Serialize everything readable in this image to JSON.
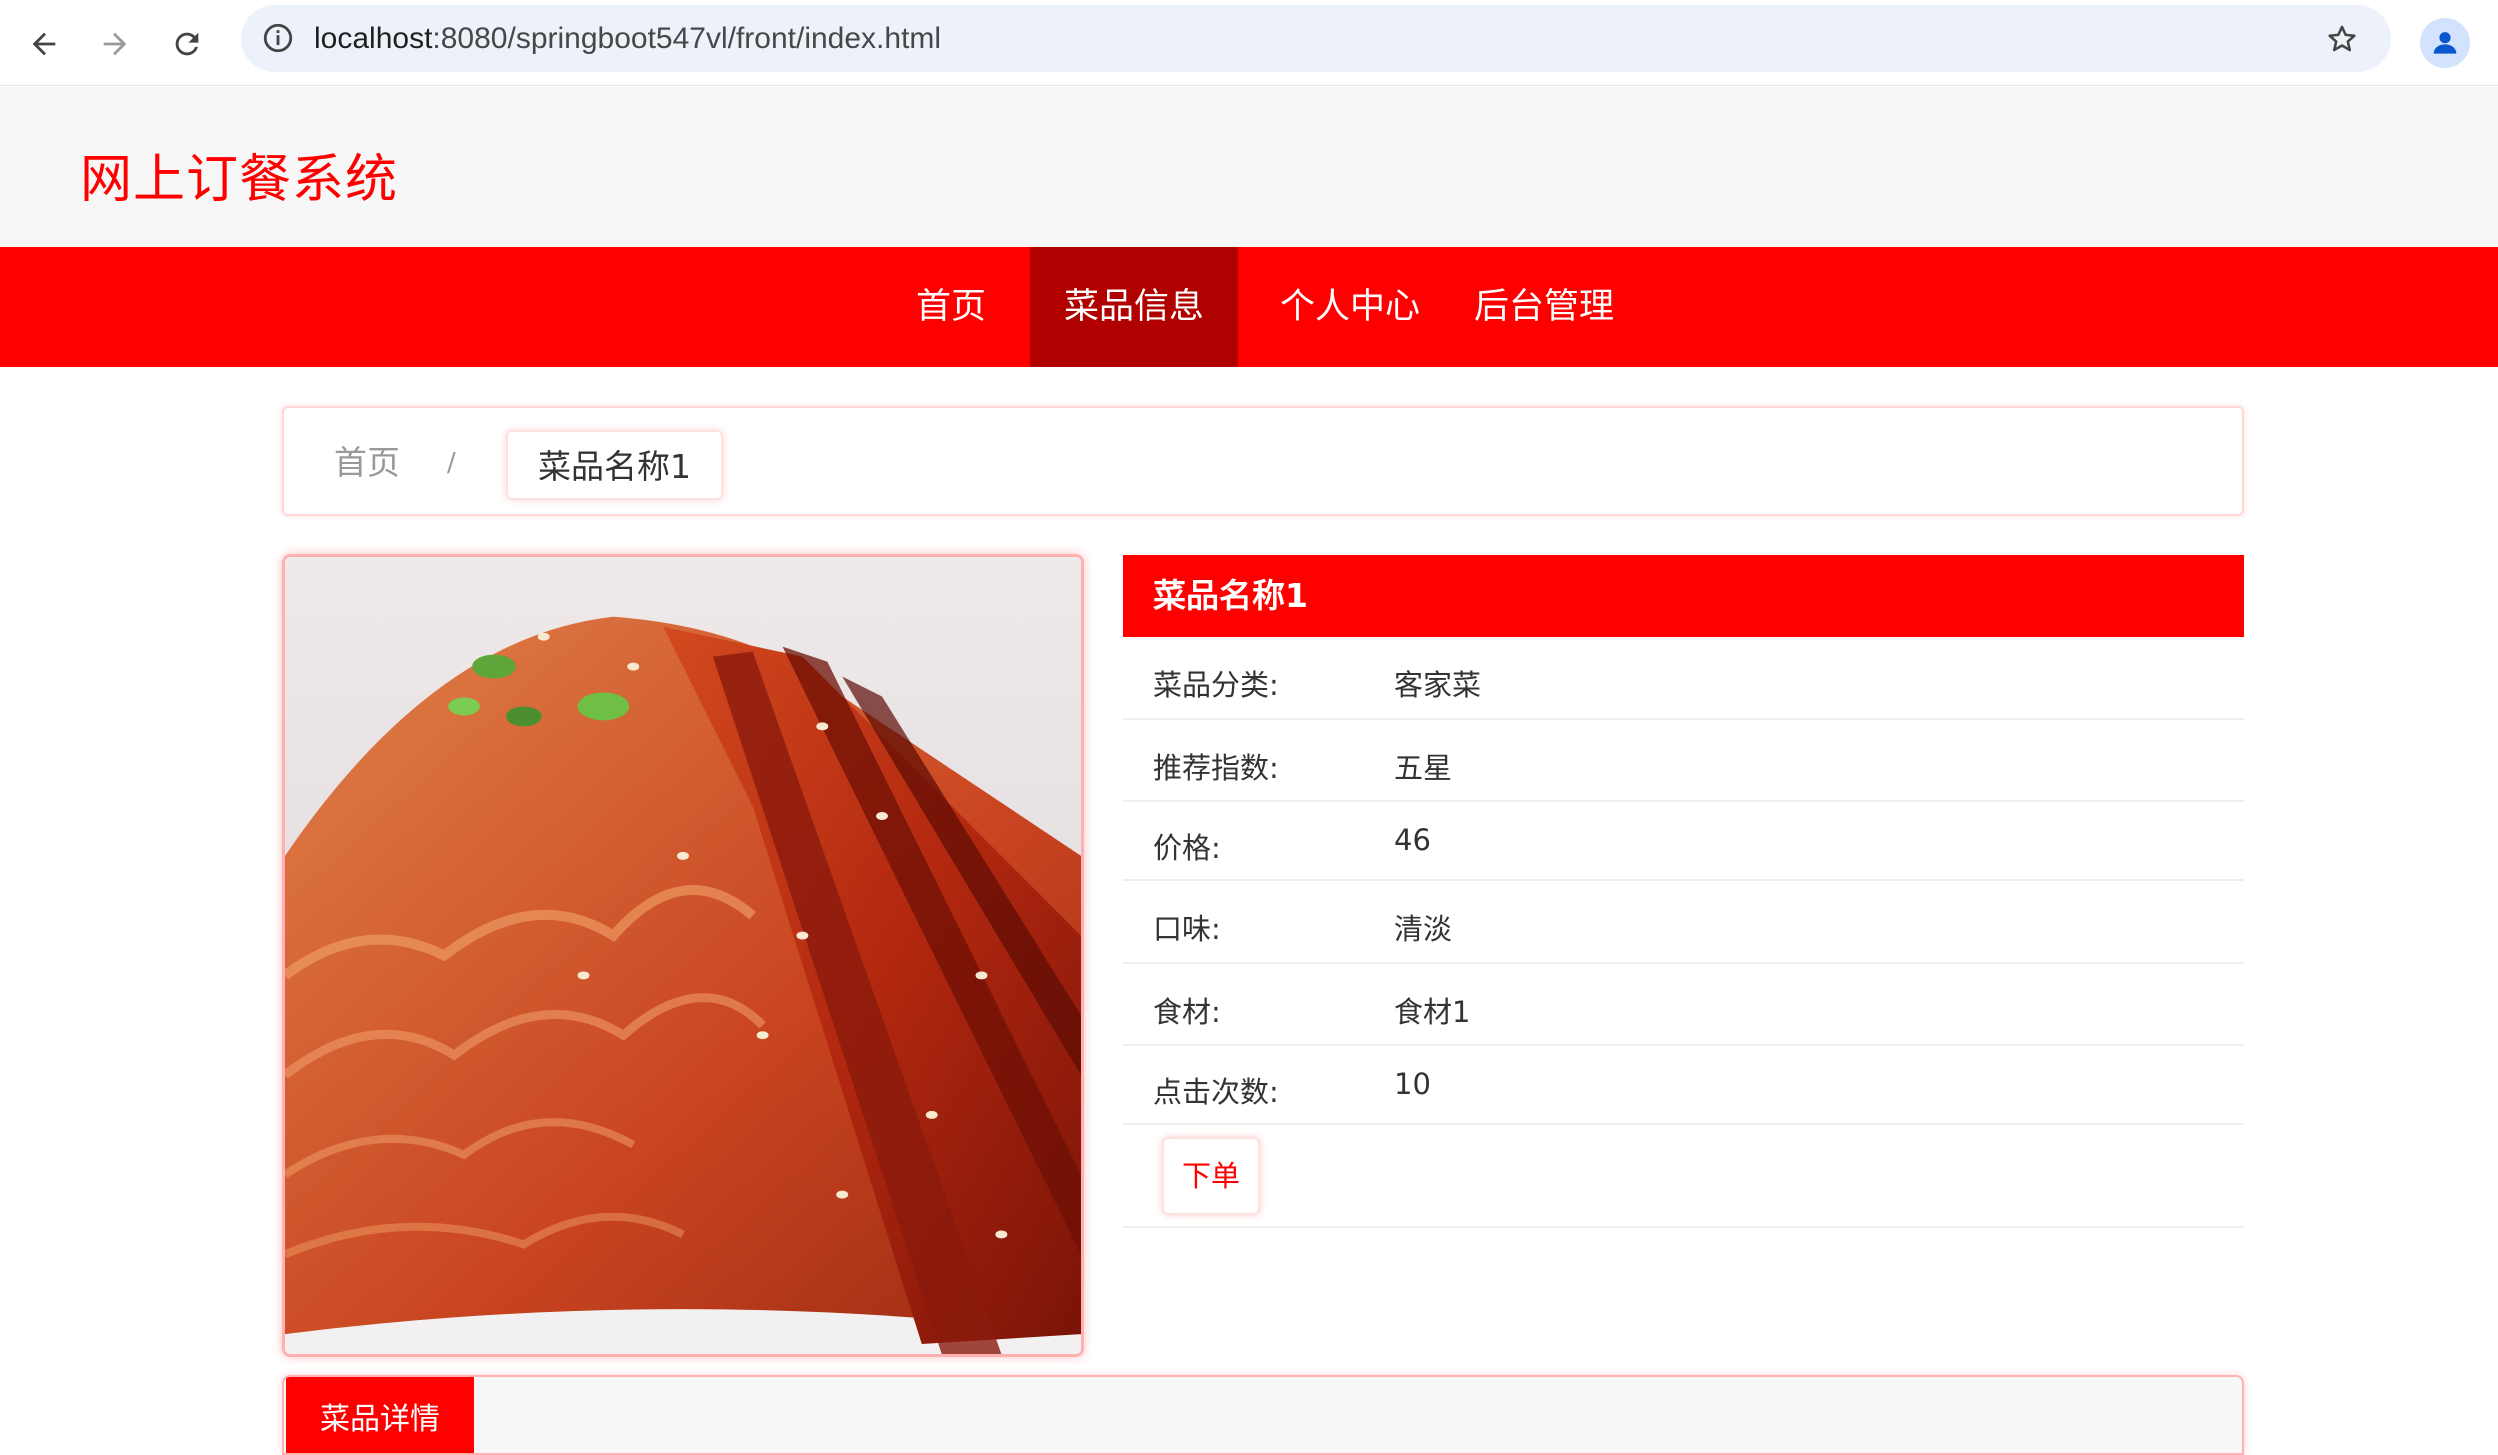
{
  "browser": {
    "url_host": "localhost",
    "url_rest": ":8080/springboot547vl/front/index.html"
  },
  "site": {
    "title": "网上订餐系统"
  },
  "nav": {
    "items": [
      {
        "label": "首页",
        "active": false
      },
      {
        "label": "菜品信息",
        "active": true
      },
      {
        "label": "个人中心",
        "active": false
      },
      {
        "label": "后台管理",
        "active": false
      }
    ]
  },
  "breadcrumb": {
    "home": "首页",
    "separator": "/",
    "current": "菜品名称1"
  },
  "product": {
    "name": "菜品名称1",
    "image_icon": "food-photo",
    "fields": [
      {
        "label": "菜品分类:",
        "value": "客家菜"
      },
      {
        "label": "推荐指数:",
        "value": "五星"
      },
      {
        "label": "价格:",
        "value": "46"
      },
      {
        "label": "口味:",
        "value": "清淡"
      },
      {
        "label": "食材:",
        "value": "食材1"
      },
      {
        "label": "点击次数:",
        "value": "10"
      }
    ],
    "order_label": "下单"
  },
  "tabs": {
    "active": "菜品详情"
  },
  "colors": {
    "brand": "#ff0000",
    "nav_active": "#b00000"
  }
}
